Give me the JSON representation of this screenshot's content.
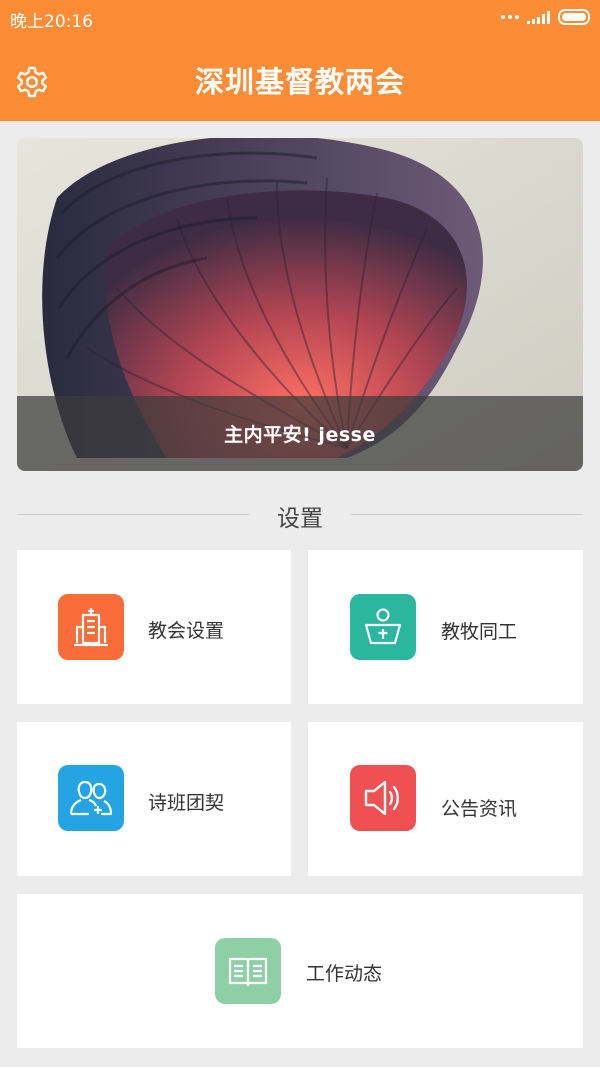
{
  "status_bar": {
    "time": "晚上20:16"
  },
  "header": {
    "title": "深圳基督教两会",
    "settings_icon": "gear-icon"
  },
  "banner": {
    "caption": "主内平安! jesse"
  },
  "section": {
    "title": "设置"
  },
  "menu": [
    {
      "label": "教会设置",
      "icon": "church-icon",
      "color": "#f86c3a"
    },
    {
      "label": "教牧同工",
      "icon": "pastor-icon",
      "color": "#2bb6a0"
    },
    {
      "label": "诗班团契",
      "icon": "fellowship-icon",
      "color": "#25a4e4"
    },
    {
      "label": "公告资讯",
      "icon": "speaker-icon",
      "color": "#ef5052"
    },
    {
      "label": "工作动态",
      "icon": "book-icon",
      "color": "#8ecfa5"
    }
  ],
  "colors": {
    "header": "#fc8c36",
    "background": "#ececec"
  }
}
